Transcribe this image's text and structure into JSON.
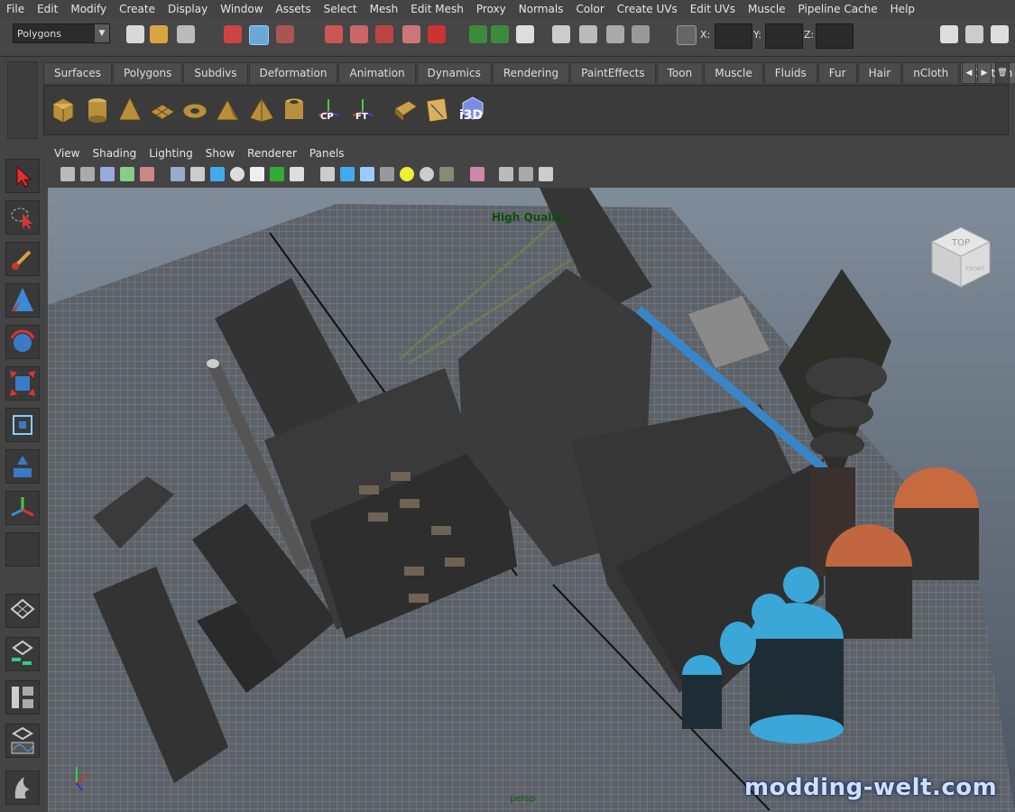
{
  "menubar": [
    "File",
    "Edit",
    "Modify",
    "Create",
    "Display",
    "Window",
    "Assets",
    "Select",
    "Mesh",
    "Edit Mesh",
    "Proxy",
    "Normals",
    "Color",
    "Create UVs",
    "Edit UVs",
    "Muscle",
    "Pipeline Cache",
    "Help"
  ],
  "toolbar": {
    "mode": "Polygons",
    "x_label": "X:",
    "y_label": "Y:",
    "z_label": "Z:"
  },
  "shelf": {
    "tabs": [
      "Surfaces",
      "Polygons",
      "Subdivs",
      "Deformation",
      "Animation",
      "Dynamics",
      "Rendering",
      "PaintEffects",
      "Toon",
      "Muscle",
      "Fluids",
      "Fur",
      "Hair",
      "nCloth",
      "Custom"
    ],
    "active_tab": "Custom",
    "icons": [
      "cube",
      "cylinder",
      "cone",
      "plane",
      "torus",
      "prism",
      "pyramid",
      "pipe",
      "cp-icon",
      "ft-icon",
      "move-icon",
      "uv-icon",
      "i3d-icon"
    ],
    "cp_label": "CP",
    "ft_label": "FT",
    "i3d_label": "i3D"
  },
  "panel_menu": [
    "View",
    "Shading",
    "Lighting",
    "Show",
    "Renderer",
    "Panels"
  ],
  "viewport": {
    "quality_label": "High Quality",
    "viewcube_label": "TOP",
    "viewcube_side": "FRONT",
    "camera_label": "persp"
  },
  "watermark": "modding-welt.com",
  "colors": {
    "ui_bg": "#444444",
    "viewport_top": "#7f8c99",
    "viewport_bottom": "#4d5562",
    "accent_blue": "#3aa7d8",
    "tank_orange": "#c86a3f"
  }
}
